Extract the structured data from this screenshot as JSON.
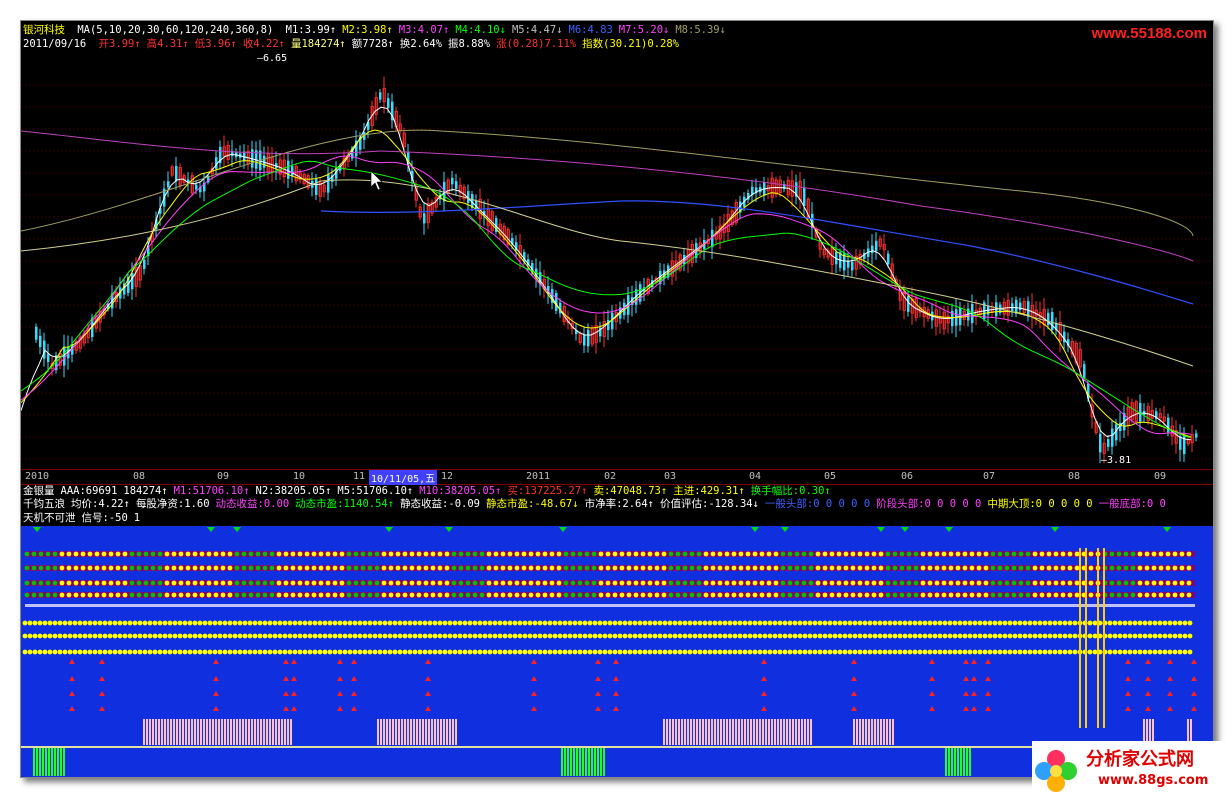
{
  "header": {
    "stock_name": "银河科技",
    "ma_label": "MA(5,10,20,30,60,120,240,360,8)",
    "ma_values": [
      {
        "text": "M1:3.99↑",
        "color": "#ffffff"
      },
      {
        "text": "M2:3.98↑",
        "color": "#ffff00"
      },
      {
        "text": "M3:4.07↑",
        "color": "#ff40ff"
      },
      {
        "text": "M4:4.10↓",
        "color": "#00ff00"
      },
      {
        "text": "M5:4.47↓",
        "color": "#c0c0c0"
      },
      {
        "text": "M6:4.83",
        "color": "#4060ff"
      },
      {
        "text": "M7:5.20↓",
        "color": "#ff40ff"
      },
      {
        "text": "M8:5.39↓",
        "color": "#a0a060"
      }
    ],
    "date": "2011/09/16",
    "quote_items": [
      {
        "text": "开3.99↑",
        "color": "#ff3030"
      },
      {
        "text": "高4.31↑",
        "color": "#ff3030"
      },
      {
        "text": "低3.96↑",
        "color": "#ff3030"
      },
      {
        "text": "收4.22↑",
        "color": "#ff3030"
      },
      {
        "text": "量184274↑",
        "color": "#ffff80"
      },
      {
        "text": "额7728↑",
        "color": "#ffffff"
      },
      {
        "text": "换2.64%",
        "color": "#ffffff"
      },
      {
        "text": "振8.88%",
        "color": "#ffffff"
      },
      {
        "text": "涨(0.28)7.11%",
        "color": "#ff3030"
      },
      {
        "text": "指数(30.21)0.28%",
        "color": "#ffff00"
      }
    ]
  },
  "chart_annotations": {
    "high_label": "6.65",
    "low_label": "3.81"
  },
  "time_axis": {
    "labels": [
      "2010",
      "08",
      "09",
      "10",
      "11",
      "12",
      "2011",
      "02",
      "03",
      "04",
      "05",
      "06",
      "07",
      "08",
      "09"
    ],
    "cursor": "10/11/05,五"
  },
  "indicator1": {
    "items": [
      {
        "text": "金银量",
        "color": "#ffffff"
      },
      {
        "text": "AAA:69691",
        "color": "#ffffff"
      },
      {
        "text": "184274↑",
        "color": "#ffffff"
      },
      {
        "text": "M1:51706.10↑",
        "color": "#ff40ff"
      },
      {
        "text": "N2:38205.05↑",
        "color": "#ffffff"
      },
      {
        "text": "M5:51706.10↑",
        "color": "#ffffff"
      },
      {
        "text": "M10:38205.05↑",
        "color": "#ff40ff"
      },
      {
        "text": "买:137225.27↑",
        "color": "#ff3030"
      },
      {
        "text": "卖:47048.73↑",
        "color": "#ffff00"
      },
      {
        "text": "主进:429.31↑",
        "color": "#ffff00"
      },
      {
        "text": "换手幅比:0.30↑",
        "color": "#00ff00"
      }
    ]
  },
  "indicator2": {
    "items": [
      {
        "text": "千钧五浪",
        "color": "#ffffff"
      },
      {
        "text": "均价:4.22↑",
        "color": "#ffffff"
      },
      {
        "text": "每股净资:1.60",
        "color": "#ffffff"
      },
      {
        "text": "动态收益:0.00",
        "color": "#ff40ff"
      },
      {
        "text": "动态市盈:1140.54↑",
        "color": "#00ff00"
      },
      {
        "text": "静态收益:-0.09",
        "color": "#ffffff"
      },
      {
        "text": "静态市盈:-48.67↓",
        "color": "#ffff00"
      },
      {
        "text": "市净率:2.64↑",
        "color": "#ffffff"
      },
      {
        "text": "价值评估:-128.34↓",
        "color": "#ffffff"
      },
      {
        "text": "一般头部:0 0 0 0 0",
        "color": "#4060ff"
      },
      {
        "text": "阶段头部:0 0 0 0 0",
        "color": "#ff40ff"
      },
      {
        "text": "中期大顶:0 0 0 0 0",
        "color": "#ffff00"
      },
      {
        "text": "一般底部:0 0",
        "color": "#ff40ff"
      }
    ]
  },
  "indicator3": {
    "items": [
      {
        "text": "天机不可泄",
        "color": "#ffffff"
      },
      {
        "text": "信号:-50",
        "color": "#ffffff"
      },
      {
        "text": "1",
        "color": "#ffffff"
      }
    ]
  },
  "watermarks": {
    "top": "www.55188.com",
    "bottom_title": "分析家公式网",
    "bottom_url": "www.88gs.com"
  },
  "colors": {
    "up": "#ff3030",
    "down": "#30e0ff",
    "panel_bg": "#1030e0"
  }
}
